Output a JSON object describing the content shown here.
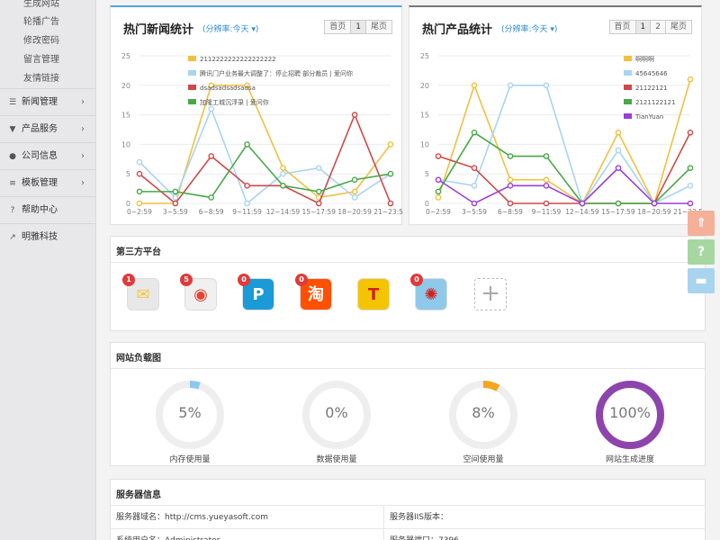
{
  "sidebar": {
    "sub_items": [
      "生成网站",
      "轮播广告",
      "修改密码",
      "留言管理",
      "友情链接"
    ],
    "nav_items": [
      {
        "label": "新闻管理",
        "icon": "list-icon",
        "glyph": "☰",
        "chev": "›"
      },
      {
        "label": "产品服务",
        "icon": "filter-icon",
        "glyph": "▼",
        "chev": "›"
      },
      {
        "label": "公司信息",
        "icon": "globe-icon",
        "glyph": "●",
        "chev": "›"
      },
      {
        "label": "模板管理",
        "icon": "layers-icon",
        "glyph": "≡",
        "chev": "›"
      },
      {
        "label": "帮助中心",
        "icon": "help-icon",
        "glyph": "?"
      },
      {
        "label": "明雅科技",
        "icon": "share-icon",
        "glyph": "↗"
      }
    ]
  },
  "news_chart": {
    "title": "热门新闻统计",
    "resolution": "(分辨率:今天 ▾)",
    "pager": {
      "first": "首页",
      "pages": [
        "1"
      ],
      "last": "尾页"
    }
  },
  "prod_chart": {
    "title": "热门产品统计",
    "resolution": "(分辨率:今天 ▾)",
    "pager": {
      "first": "首页",
      "pages": [
        "1",
        "2"
      ],
      "last": "尾页"
    }
  },
  "chart_data": [
    {
      "type": "line",
      "title": "热门新闻统计",
      "categories": [
        "0~2:59",
        "3~5:59",
        "6~8:59",
        "9~11:59",
        "12~14:59",
        "15~17:59",
        "18~20:59",
        "21~23:59"
      ],
      "ylim": [
        0,
        25
      ],
      "yticks": [
        0,
        5,
        10,
        15,
        20,
        25
      ],
      "grid": true,
      "legend": "top-center",
      "series": [
        {
          "name": "2112222222222222222",
          "color": "#f0c040",
          "values": [
            0,
            0,
            20,
            20,
            6,
            1,
            2,
            10
          ]
        },
        {
          "name": "腾讯门户业务最大调整了：停止招聘 部分裁员 | 爱问你",
          "color": "#a8d4f2",
          "values": [
            7,
            1,
            16,
            0,
            5,
            6,
            1,
            5
          ]
        },
        {
          "name": "dsadsadsadsadsa",
          "color": "#d04848",
          "values": [
            5,
            0,
            8,
            3,
            3,
            0,
            15,
            0
          ]
        },
        {
          "name": "加隆工城沉浮录 | 爱问你",
          "color": "#48a848",
          "values": [
            2,
            2,
            1,
            10,
            3,
            2,
            4,
            5
          ]
        }
      ]
    },
    {
      "type": "line",
      "title": "热门产品统计",
      "categories": [
        "0~2:59",
        "3~5:59",
        "6~8:59",
        "9~11:59",
        "12~14:59",
        "15~17:59",
        "18~20:59",
        "21~23:59"
      ],
      "ylim": [
        0,
        25
      ],
      "yticks": [
        0,
        5,
        10,
        15,
        20,
        25
      ],
      "grid": true,
      "legend": "top-right",
      "series": [
        {
          "name": "啊啊啊",
          "color": "#f0c040",
          "values": [
            1,
            20,
            4,
            4,
            0,
            12,
            0,
            21
          ]
        },
        {
          "name": "45645646",
          "color": "#a8d4f2",
          "values": [
            4,
            3,
            20,
            20,
            0,
            9,
            0,
            3
          ]
        },
        {
          "name": "21122121",
          "color": "#d04848",
          "values": [
            8,
            6,
            0,
            0,
            0,
            0,
            0,
            12
          ]
        },
        {
          "name": "2121122121",
          "color": "#48a848",
          "values": [
            2,
            12,
            8,
            8,
            0,
            0,
            0,
            6
          ]
        },
        {
          "name": "TianYuan",
          "color": "#9b3fd8",
          "values": [
            4,
            0,
            3,
            3,
            0,
            6,
            0,
            0
          ]
        }
      ]
    }
  ],
  "third_party": {
    "title": "第三方平台",
    "apps": [
      {
        "name": "mail-app-icon",
        "badge": "1",
        "glyph": "✉",
        "color": "#f5c842",
        "bg": "#e8e8e8"
      },
      {
        "name": "weibo-app-icon",
        "badge": "5",
        "glyph": "◉",
        "color": "#e8432e",
        "bg": "#f0f0f0"
      },
      {
        "name": "pinterest-app-icon",
        "badge": "0",
        "glyph": "P",
        "color": "#ffffff",
        "bg": "#1a9ad6"
      },
      {
        "name": "taobao-app-icon",
        "badge": "0",
        "glyph": "淘",
        "color": "#ffffff",
        "bg": "#ff5000"
      },
      {
        "name": "t-app-icon",
        "badge": "",
        "glyph": "T",
        "color": "#d02020",
        "bg": "#f5c400"
      },
      {
        "name": "qq-weibo-app-icon",
        "badge": "0",
        "glyph": "✺",
        "color": "#d02020",
        "bg": "#8fc9ea"
      }
    ],
    "add_label": "+"
  },
  "site_load": {
    "title": "网站负载图",
    "gauges": [
      {
        "label": "内存使用量",
        "value": "5%",
        "percent": 5,
        "color": "#8cc9ef"
      },
      {
        "label": "数据使用量",
        "value": "0%",
        "percent": 0,
        "color": "#8cc9ef"
      },
      {
        "label": "空间使用量",
        "value": "8%",
        "percent": 8,
        "color": "#f4a621"
      },
      {
        "label": "网站生成进度",
        "value": "100%",
        "percent": 100,
        "color": "#8e44ad"
      }
    ]
  },
  "server": {
    "title": "服务器信息",
    "rows": [
      {
        "left": "服务器域名：http://cms.yueyasoft.com",
        "right": "服务器IIS版本："
      },
      {
        "left": "系统用户名：Administrator",
        "right": "服务器端口：7396"
      }
    ]
  },
  "float_buttons": [
    {
      "name": "back-to-top-icon",
      "glyph": "⇑",
      "color": "#f5b09a"
    },
    {
      "name": "help-float-icon",
      "glyph": "?",
      "color": "#a6d7a1"
    },
    {
      "name": "chat-float-icon",
      "glyph": "▬",
      "color": "#a9d4f0"
    }
  ]
}
